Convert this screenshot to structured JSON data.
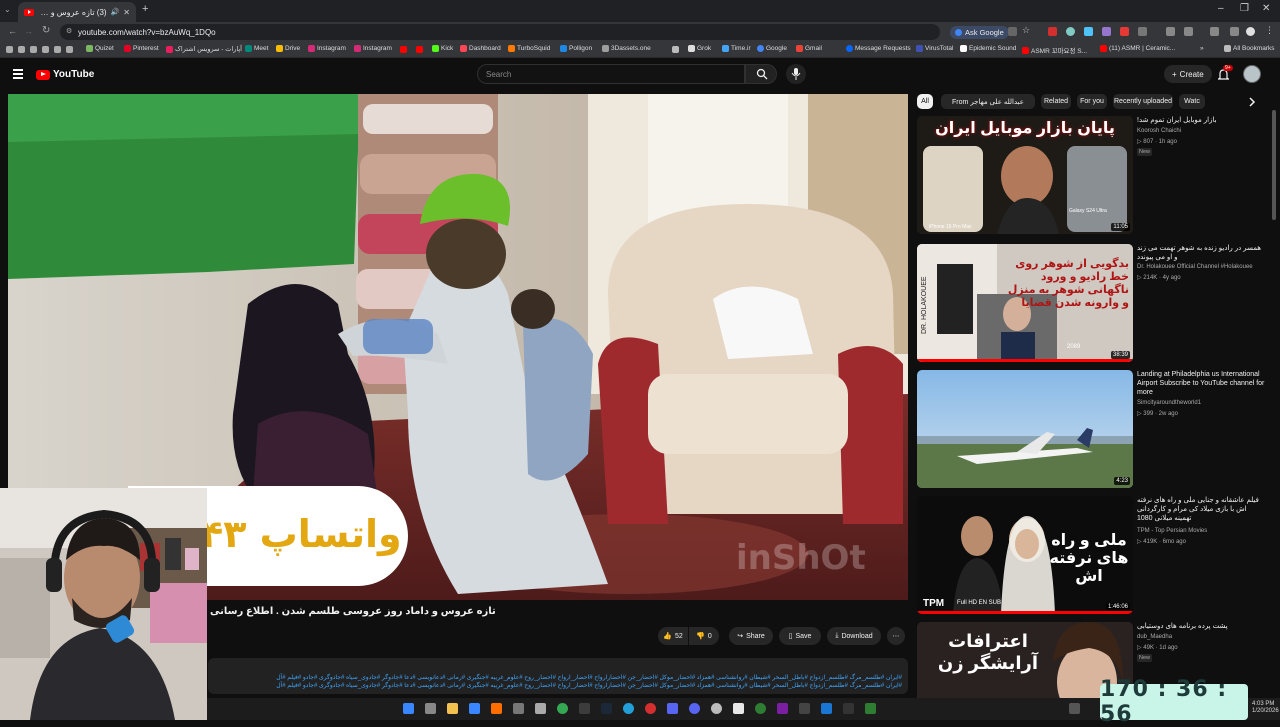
{
  "browser": {
    "tab_title": "(3) تازه عروس و داماد روز عرو",
    "new_tab": "+",
    "url": "youtube.com/watch?v=bzAuWq_1DQo",
    "ask_google": "Ask Google",
    "window_controls": [
      "–",
      "❐",
      "✕"
    ],
    "bookmarks": [
      {
        "label": "Quizet",
        "color": "#7bb661"
      },
      {
        "label": "Pinterest",
        "color": "#e60023"
      },
      {
        "label": "آپارات - سرویس اشتراک",
        "color": "#ea1d5d"
      },
      {
        "label": "Meet",
        "color": "#00897b"
      },
      {
        "label": "Drive",
        "color": "#fbbc04"
      },
      {
        "label": "Instagram",
        "color": "#d62976"
      },
      {
        "label": "Instagram",
        "color": "#d62976"
      },
      {
        "label": "Kick",
        "color": "#53fc18"
      },
      {
        "label": "Dashboard",
        "color": "#ff4655"
      },
      {
        "label": "TurboSquid",
        "color": "#ff7a00"
      },
      {
        "label": "Polligon",
        "color": "#1e88e5"
      },
      {
        "label": "3Dassets.one",
        "color": "#9e9e9e"
      },
      {
        "label": "Grok",
        "color": "#dddddd"
      },
      {
        "label": "Time.ir",
        "color": "#42a5f5"
      },
      {
        "label": "Google",
        "color": "#4285f4"
      },
      {
        "label": "Gmail",
        "color": "#ea4335"
      },
      {
        "label": "Message Requests",
        "color": "#0866ff"
      },
      {
        "label": "VirusTotal",
        "color": "#3f51b5"
      },
      {
        "label": "Epidemic Sound",
        "color": "#ffffff"
      },
      {
        "label": "ASMR 꼬마요정 S...",
        "color": "#ff0000"
      },
      {
        "label": "(11) ASMR | Ceramic...",
        "color": "#ff0000"
      },
      {
        "label": "All Bookmarks",
        "color": "#bbbbbb"
      }
    ]
  },
  "youtube": {
    "logo": "YouTube",
    "search_placeholder": "Search",
    "create_label": "Create",
    "notif_count": "9+",
    "video_title": "تازه عروس و داماد روز عروسی طلسم شدن . اطلاع رسانی",
    "overlay_text": "واتساپ ۴۳",
    "watermark": "inShOt",
    "likes": "52",
    "dislikes": "0",
    "share_label": "Share",
    "save_label": "Save",
    "download_label": "Download",
    "description": "#ایران #طلسم_مرگ #طلسم_ازدواج #باطل_السحر #شیطان #روانشناسی #همزاد #احضار_موکل #احضار_جن #احضارارواح #احضار_ارواح #احضار_روح #علوم_غریبه #جنگیری #رمانی #دعانویسی #دعا #جادوگر #جادوی_سیاه #جادوگری #جادو #فیلم #آل\n#ایران #طلسم_مرگ #طلسم_ازدواج #باطل_السحر #شیطان #روانشناسی #همزاد #احضار_موکل #احضار_جن #احضارارواح #احضار_ارواح #احضار_روح #علوم_غریبه #جنگیری #رمانی #دعانویسی #دعا #جادوگر #جادوی_سیاه #جادوگری #جادو #فیلم #آل"
  },
  "chips": [
    "All",
    "From عبدالله علی مهاجر",
    "Related",
    "For you",
    "Recently uploaded",
    "Watc"
  ],
  "recommendations": [
    {
      "title": "بازار موبایل ایران تموم شد!",
      "channel": "Koorosh Chaichi",
      "meta": "807 · 1h ago",
      "badge": "New",
      "duration": "11:05",
      "thumb_text": "پایان بازار موبایل ایران",
      "thumb_sub": "Galaxy S24 Ultra",
      "thumb_sub2": "iPhone 16 Pro Max"
    },
    {
      "title": "همسر در رادیو زنده به شوهر تهمت می زند و او می پیوندد",
      "channel": "Dr. Holakouee Official Channel #Holakouee",
      "meta": "214K · 4y ago",
      "badge": "",
      "duration": "38:39",
      "thumb_text": "بدگویی از شوهر روی خط رادیو و ورود ناگهانی شوهر به منزل و وارونه شدن قضایا",
      "thumb_sub": "DR. HOLAKOUEE",
      "thumb_sub2": "2089"
    },
    {
      "title": "Landing at Philadelphia us International Airport Subscribe to YouTube channel for more",
      "channel": "Simcityaroundtheworld1",
      "meta": "399 · 2w ago",
      "badge": "",
      "duration": "4:23",
      "thumb_text": "",
      "thumb_sub": "",
      "thumb_sub2": ""
    },
    {
      "title": "فیلم عاشقانه و جنایی ملی و راه های نرفته اش با بازی میلاد کی مرام و کارگردانی تهمینه میلانی 1080",
      "channel": "TPM - Top Persian Movies",
      "meta": "419K · 6mo ago",
      "badge": "",
      "duration": "1:46:06",
      "thumb_text": "ملی و راه های نرفته اش",
      "thumb_sub": "TPM",
      "thumb_sub2": "Full HD  EN SUB"
    },
    {
      "title": "پشت پرده برنامه های دوستیابی",
      "channel": "dub_Maedha",
      "meta": "49K · 1d ago",
      "badge": "New",
      "duration": "",
      "thumb_text": "اعترافات آرایشگر زن",
      "thumb_sub": "",
      "thumb_sub2": ""
    }
  ],
  "timer": "170 : 36 : 56",
  "clock": {
    "time": "4:03 PM",
    "date": "1/20/2026"
  },
  "colors": {
    "youtube_red": "#ff0000",
    "bg": "#0f0f0f",
    "timer_bg": "#c9f5e8"
  }
}
